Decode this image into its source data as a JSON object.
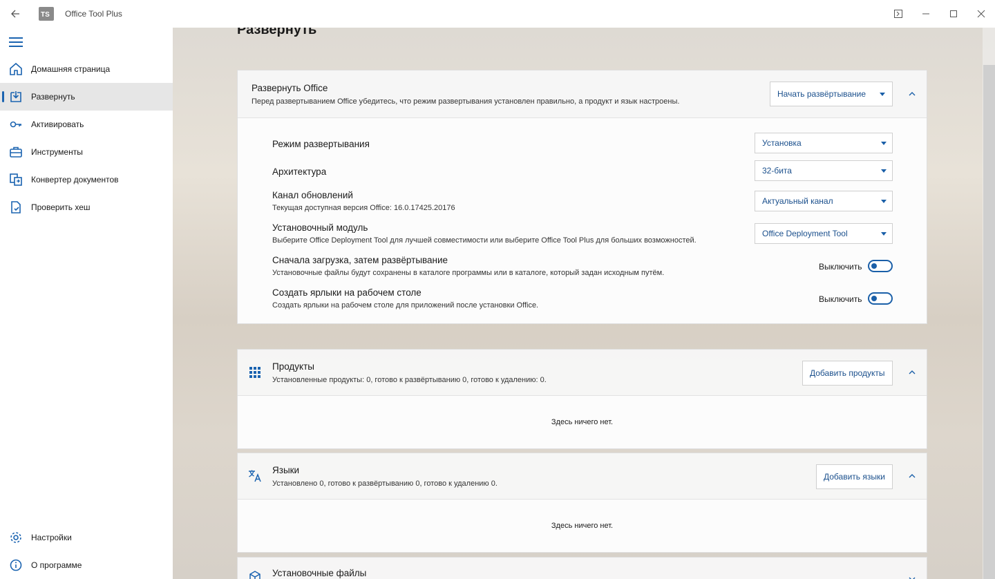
{
  "window": {
    "title": "Office Tool Plus",
    "logo_text": "TS"
  },
  "sidebar": {
    "items": [
      {
        "label": "Домашняя страница",
        "icon": "home-icon"
      },
      {
        "label": "Развернуть",
        "icon": "deploy-icon",
        "active": true
      },
      {
        "label": "Активировать",
        "icon": "key-icon"
      },
      {
        "label": "Инструменты",
        "icon": "toolbox-icon"
      },
      {
        "label": "Конвертер документов",
        "icon": "convert-icon"
      },
      {
        "label": "Проверить хеш",
        "icon": "hash-check-icon"
      }
    ],
    "bottom_items": [
      {
        "label": "Настройки",
        "icon": "gear-icon"
      },
      {
        "label": "О программе",
        "icon": "info-icon"
      }
    ]
  },
  "page": {
    "title": "Развернуть"
  },
  "deploy_card": {
    "title": "Развернуть Office",
    "subtitle": "Перед развертыванием Office убедитесь, что режим развертывания установлен правильно, а продукт и язык настроены.",
    "start_button": "Начать развёртывание",
    "rows": {
      "mode": {
        "label": "Режим развертывания",
        "value": "Установка"
      },
      "arch": {
        "label": "Архитектура",
        "value": "32-бита"
      },
      "channel": {
        "label": "Канал обновлений",
        "sub": "Текущая доступная версия Office: 16.0.17425.20176",
        "value": "Актуальный канал"
      },
      "module": {
        "label": "Установочный модуль",
        "sub": "Выберите Office Deployment Tool для лучшей совместимости или выберите Office Tool Plus для больших возможностей.",
        "value": "Office Deployment Tool"
      },
      "download_first": {
        "label": "Сначала загрузка, затем развёртывание",
        "sub": "Установочные файлы будут сохранены в каталоге программы или в каталоге, который задан исходным путём.",
        "toggle": "Выключить"
      },
      "shortcuts": {
        "label": "Создать ярлыки на рабочем столе",
        "sub": "Создать ярлыки на рабочем столе для приложений после установки Office.",
        "toggle": "Выключить"
      }
    }
  },
  "products_card": {
    "title": "Продукты",
    "subtitle": "Установленные продукты: 0, готово к развёртыванию 0, готово к удалению: 0.",
    "button": "Добавить продукты",
    "empty": "Здесь ничего нет."
  },
  "languages_card": {
    "title": "Языки",
    "subtitle": "Установлено 0, готово к развёртыванию 0, готово к удалению 0.",
    "button": "Добавить языки",
    "empty": "Здесь ничего нет."
  },
  "files_card": {
    "title": "Установочные файлы"
  },
  "colors": {
    "accent": "#1a63b0"
  }
}
